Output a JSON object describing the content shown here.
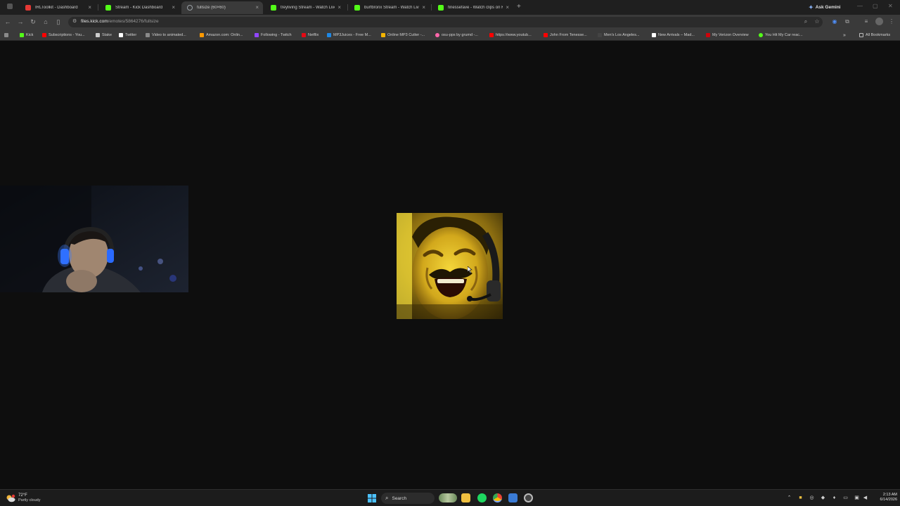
{
  "tabs": [
    {
      "title": "IRLToolkit - Dashboard",
      "favicon_color": "#e53935",
      "active": false
    },
    {
      "title": "Stream - Kick Dashboard",
      "favicon_color": "#53fc18",
      "active": false
    },
    {
      "title": "fullsize (60×60)",
      "favicon_color": "#9aa0a6",
      "active": true
    },
    {
      "title": "treyliving Stream - Watch Live o",
      "favicon_color": "#53fc18",
      "active": false
    },
    {
      "title": "burfbronx Stream - Watch Live o",
      "favicon_color": "#53fc18",
      "active": false
    },
    {
      "title": "finessefave - Watch clips on Kic",
      "favicon_color": "#53fc18",
      "active": false
    }
  ],
  "ask_gemini_label": "Ask Gemini",
  "address_bar": {
    "host": "files.kick.com",
    "path": "/emotes/5864276/fullsize"
  },
  "bookmarks": [
    {
      "label": "Kick",
      "icon_color": "#53fc18"
    },
    {
      "label": "Subscriptions - You...",
      "icon_color": "#ff0000"
    },
    {
      "label": "Stake",
      "icon_color": "#cccccc"
    },
    {
      "label": "Twitter",
      "icon_color": "#ffffff"
    },
    {
      "label": "Video to animated...",
      "icon_color": "#8a8a8a"
    },
    {
      "label": "Amazon.com: Onlin...",
      "icon_color": "#ff9900"
    },
    {
      "label": "Following - Twitch",
      "icon_color": "#9146ff"
    },
    {
      "label": "Netflix",
      "icon_color": "#e50914"
    },
    {
      "label": "MP3Juices - Free M...",
      "icon_color": "#1e88e5"
    },
    {
      "label": "Online MP3 Cutter -...",
      "icon_color": "#f4b400"
    },
    {
      "label": "osu-pps by grumd -...",
      "icon_color": "#ff66aa"
    },
    {
      "label": "https://www.youtub...",
      "icon_color": "#ff0000"
    },
    {
      "label": "John From Tenesse...",
      "icon_color": "#ff0000"
    },
    {
      "label": "Men's Los Angeles...",
      "icon_color": "#444444"
    },
    {
      "label": "New Arrivals – Mad...",
      "icon_color": "#ffffff"
    },
    {
      "label": "My Verizon Overview",
      "icon_color": "#cd040b"
    },
    {
      "label": "You Hit My Car reac...",
      "icon_color": "#53fc18"
    }
  ],
  "all_bookmarks_label": "All Bookmarks",
  "taskbar": {
    "weather_temp": "72°F",
    "weather_condition": "Partly cloudy",
    "search_label": "Search",
    "time": "2:13 AM",
    "date": "6/14/2026"
  },
  "colors": {
    "page_background": "#0e0e0e",
    "kick_green": "#53fc18",
    "emote_yellow": "#e8c21a"
  }
}
